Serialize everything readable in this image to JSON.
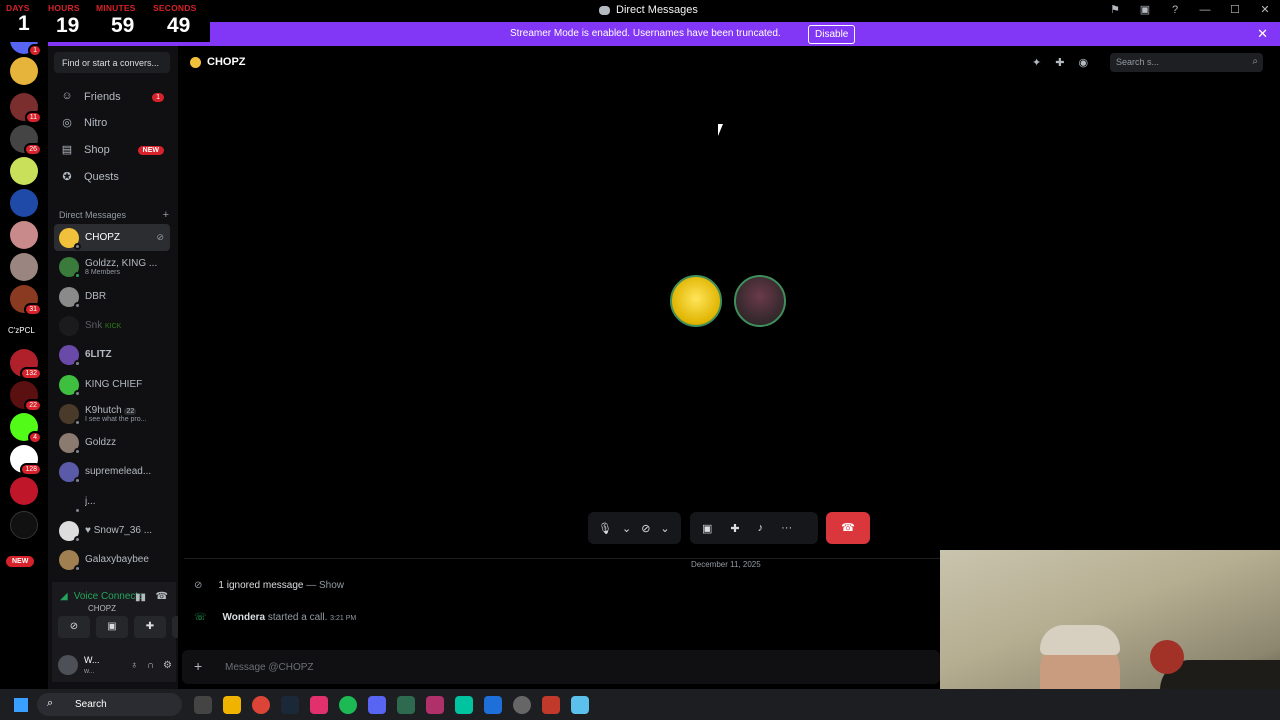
{
  "timer": {
    "labels": [
      "DAYS",
      "HOURS",
      "MINUTES",
      "SECONDS"
    ],
    "values": [
      "1",
      "19",
      "59",
      "49"
    ]
  },
  "window": {
    "title": "Direct Messages"
  },
  "banner": {
    "message": "Streamer Mode is enabled. Usernames have been truncated.",
    "button": "Disable"
  },
  "servers": {
    "badges": [
      "1",
      "11",
      "26",
      "31",
      "132",
      "22",
      "4",
      "128"
    ],
    "text_server": "C'zPCL",
    "new_label": "NEW"
  },
  "dm_panel": {
    "find_placeholder": "Find or start a convers...",
    "nav": [
      {
        "label": "Friends",
        "badge": "1"
      },
      {
        "label": "Nitro"
      },
      {
        "label": "Shop",
        "badge": "NEW"
      },
      {
        "label": "Quests"
      }
    ],
    "dm_header": "Direct Messages",
    "dms": [
      {
        "name": "CHOPZ"
      },
      {
        "name": "Goldzz, KING ...",
        "sub": "8 Members"
      },
      {
        "name": "DBR"
      },
      {
        "name": "Snk",
        "tag": "KICK"
      },
      {
        "name": "6LITZ"
      },
      {
        "name": "KING CHIEF"
      },
      {
        "name": "K9hutch",
        "sub": "I see what the pro...",
        "tag": "22"
      },
      {
        "name": "Goldzz"
      },
      {
        "name": "supremelead..."
      },
      {
        "name": "j..."
      },
      {
        "name": "♥ Snow7_36 ..."
      },
      {
        "name": "Galaxybaybee"
      }
    ]
  },
  "voice": {
    "status": "Voice Connecte",
    "channel": "CHOPZ",
    "user": "W...",
    "user_sub": "w..."
  },
  "main": {
    "channel_name": "CHOPZ",
    "search_placeholder": "Search s...",
    "date": "December 11, 2025",
    "ignored": "1 ignored message",
    "ignored_sep": "—",
    "ignored_show": "Show",
    "caller": "Wondera",
    "call_text": "started a call.",
    "call_time": "3:21 PM",
    "composer_placeholder": "Message @CHOPZ"
  },
  "taskbar": {
    "search": "Search"
  },
  "colors": {
    "banner": "#8237f6",
    "hangup": "#da373c",
    "online": "#23a55a",
    "badge": "#d6222a"
  }
}
